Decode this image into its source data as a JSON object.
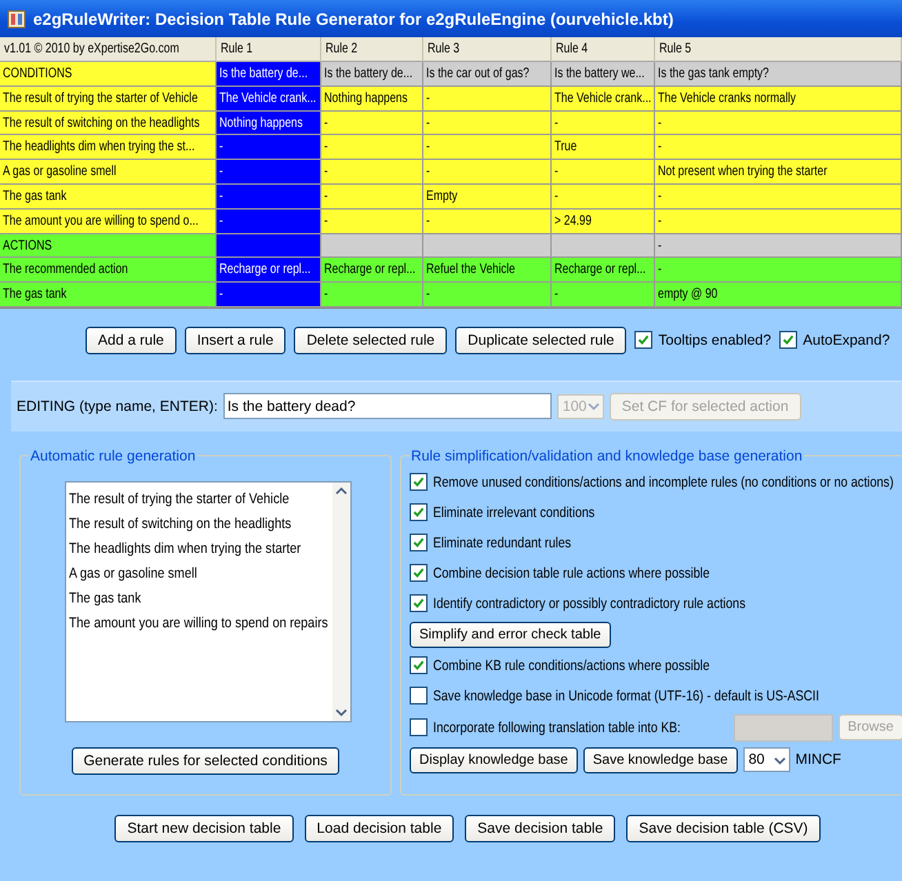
{
  "window": {
    "title": "e2gRuleWriter: Decision Table Rule Generator for e2gRuleEngine (ourvehicle.kbt)"
  },
  "table": {
    "columns": [
      {
        "label": "v1.01 © 2010 by eXpertise2Go.com"
      },
      {
        "label": "Rule 1",
        "selected": true
      },
      {
        "label": "Rule 2",
        "selected": false
      },
      {
        "label": "Rule 3",
        "selected": false
      },
      {
        "label": "Rule 4",
        "selected": false
      },
      {
        "label": "Rule 5",
        "selected": false
      }
    ],
    "rows": [
      {
        "kind": "conditions",
        "cells": [
          "CONDITIONS",
          "Is the battery de...",
          "Is the battery de...",
          "Is the car out of gas?",
          "Is the battery we...",
          "Is the gas tank empty?"
        ]
      },
      {
        "kind": "condition",
        "cells": [
          "The result of trying the starter of Vehicle",
          "The Vehicle crank...",
          "Nothing happens",
          "-",
          "The Vehicle crank...",
          "The Vehicle cranks normally"
        ]
      },
      {
        "kind": "condition",
        "cells": [
          "The result of switching on the headlights",
          "Nothing happens",
          "-",
          "-",
          "-",
          "-"
        ]
      },
      {
        "kind": "condition",
        "cells": [
          "The headlights dim when trying the st...",
          "-",
          "-",
          "-",
          "True",
          "-"
        ]
      },
      {
        "kind": "condition",
        "cells": [
          "A gas or gasoline smell",
          "-",
          "-",
          "-",
          "-",
          "Not present when trying the starter"
        ]
      },
      {
        "kind": "condition",
        "cells": [
          "The gas tank",
          "-",
          "-",
          "Empty",
          "-",
          "-"
        ]
      },
      {
        "kind": "condition",
        "cells": [
          "The amount you are willing to spend o...",
          "-",
          "-",
          "-",
          "> 24.99",
          "-"
        ]
      },
      {
        "kind": "actions",
        "cells": [
          "ACTIONS",
          "",
          "",
          "",
          "",
          "-"
        ]
      },
      {
        "kind": "action",
        "cells": [
          "The recommended action",
          "Recharge or repl...",
          "Recharge or repl...",
          "Refuel the Vehicle",
          "Recharge or repl...",
          "-"
        ]
      },
      {
        "kind": "action",
        "cells": [
          "The gas tank",
          "-",
          "-",
          "-",
          "-",
          "empty @ 90"
        ]
      }
    ]
  },
  "rule_buttons": [
    "Add a rule",
    "Insert a rule",
    "Delete selected rule",
    "Duplicate selected rule"
  ],
  "rule_options": [
    {
      "label": "Tooltips enabled?",
      "checked": true
    },
    {
      "label": "AutoExpand?",
      "checked": true
    }
  ],
  "editing": {
    "label": "EDITING (type name, ENTER):",
    "value": "Is the battery dead?",
    "cf": {
      "value": "100",
      "disabled": true
    },
    "button": {
      "label": "Set CF for selected action",
      "disabled": true
    }
  },
  "auto_generation": {
    "title": "Automatic rule generation",
    "conditions": [
      "The result of trying the starter of Vehicle",
      "The result of switching on the headlights",
      "The headlights dim when trying the starter",
      "A gas or gasoline smell",
      "The gas tank",
      "The amount you are willing to spend on repairs"
    ],
    "button": "Generate rules for selected conditions"
  },
  "simplification": {
    "title": "Rule simplification/validation and knowledge base generation",
    "options": [
      {
        "label": "Remove unused conditions/actions and incomplete rules (no conditions or no actions)",
        "checked": true
      },
      {
        "label": "Eliminate irrelevant conditions",
        "checked": true
      },
      {
        "label": "Eliminate redundant rules",
        "checked": true
      },
      {
        "label": "Combine decision table rule actions where possible",
        "checked": true
      },
      {
        "label": "Identify contradictory or possibly contradictory rule actions",
        "checked": true
      }
    ],
    "button": "Simplify and error check table",
    "kb_options": [
      {
        "label": "Combine KB rule conditions/actions where possible",
        "checked": true
      },
      {
        "label": "Save knowledge base in Unicode format (UTF-16) - default is US-ASCII",
        "checked": false
      },
      {
        "label": "Incorporate following translation table into KB:",
        "checked": false
      }
    ],
    "translation_field": {
      "disabled": true
    },
    "browse_button": {
      "label": "Browse",
      "disabled": true
    },
    "kb_buttons": [
      "Display knowledge base",
      "Save knowledge base"
    ],
    "mincf": {
      "value": "80",
      "label": "MINCF"
    }
  },
  "file_buttons": [
    "Start new decision table",
    "Load decision table",
    "Save decision table",
    "Save decision table (CSV)"
  ]
}
